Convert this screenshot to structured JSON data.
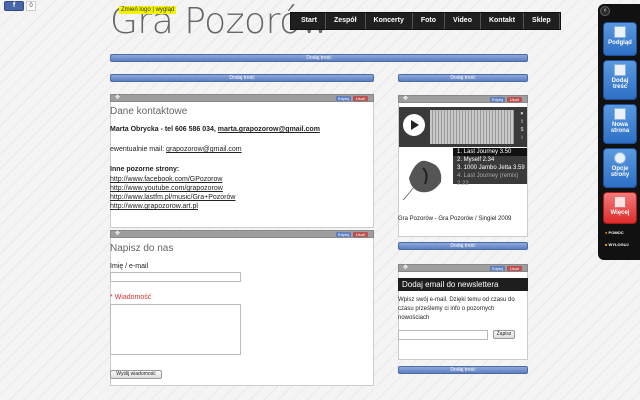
{
  "social": {
    "fb_label": "f",
    "fb_count": "0"
  },
  "logo": {
    "text": "Gra Pozorów",
    "note": "Zmień logo | wygląd"
  },
  "nav": [
    "Start",
    "Zespół",
    "Koncerty",
    "Foto",
    "Video",
    "Kontakt",
    "Sklep"
  ],
  "add_content": "Dodaj treść",
  "panel_controls": {
    "edit": "Edytuj",
    "delete": "Usuń",
    "move": "✥"
  },
  "contact": {
    "title": "Dane kontaktowe",
    "line1_bold": "Marta Obrycka - tel 606 586 034,",
    "line1_email": "marta.grapozorow@gmail.com",
    "alt_label": "ewentualnie mail:",
    "alt_email": "grapozorow@gmail.com",
    "other_label": "Inne pozorne strony:",
    "links": [
      "http://www.facebook.com/GPozorow",
      "http://www.youtube.com/grapozorow",
      "http://www.lastfm.pl/music/Gra+Pozorów",
      "http://www.grapozorow.art.pl"
    ]
  },
  "form": {
    "title": "Napisz do nas",
    "name_label": "Imię / e-mail",
    "message_label": "Wiadomość",
    "required_mark": "*",
    "submit": "Wyślij wiadomość"
  },
  "player": {
    "tracks": [
      "1. Last Journey 3.50",
      "2. Myself 2.34",
      "3. 1000 Jambo Jetta 3.59",
      "4. Last Journey (remix) 2.22"
    ],
    "caption": "Gra Pozorów - Gra Pozorów / Singiel 2009"
  },
  "newsletter": {
    "title": "Dodaj email do newslettera",
    "text": "Wpisz swój e-mail. Dzięki temu od czasu do czasu prześlemy ci info o pozornych nowościach",
    "submit": "Zapisz"
  },
  "sidebar": {
    "toggle": "‹",
    "buttons": [
      "Podgląd",
      "Dodaj treść",
      "Nowa strona",
      "Opcje strony",
      "Więcej"
    ],
    "help": "POMOC",
    "logout": "WYLOGUJ"
  }
}
